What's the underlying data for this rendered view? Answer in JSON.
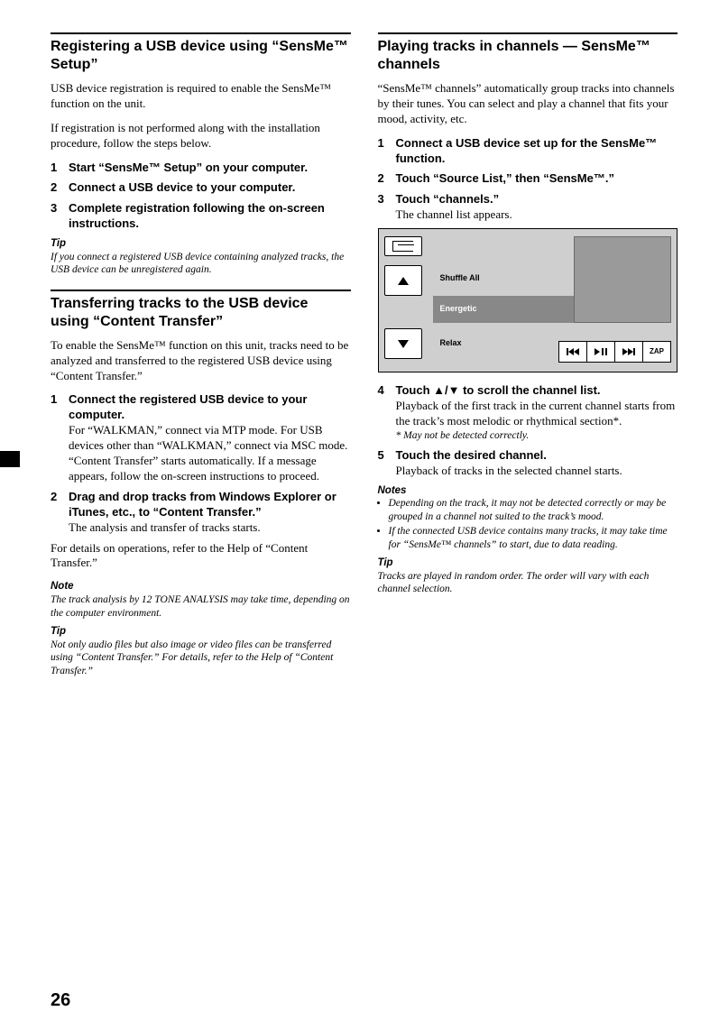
{
  "page_number": "26",
  "left": {
    "sect1_title": "Registering a USB device using “SensMe™ Setup”",
    "sect1_p1": "USB device registration is required to enable the SensMe™ function on the unit.",
    "sect1_p2": "If registration is not performed along with the installation procedure, follow the steps below.",
    "sect1_steps": [
      {
        "head": "Start “SensMe™ Setup” on your computer."
      },
      {
        "head": "Connect a USB device to your computer."
      },
      {
        "head": "Complete registration following the on-screen instructions."
      }
    ],
    "sect1_tip_label": "Tip",
    "sect1_tip": "If you connect a registered USB device containing analyzed tracks, the USB device can be unregistered again.",
    "sect2_title": "Transferring tracks to the USB device using “Content Transfer”",
    "sect2_p1": "To enable the SensMe™ function on this unit, tracks need to be analyzed and transferred to the registered USB device using “Content Transfer.”",
    "sect2_steps": [
      {
        "head": "Connect the registered USB device to your computer.",
        "body": "For “WALKMAN,” connect via MTP mode. For USB devices other than “WALKMAN,” connect via MSC mode. “Content Transfer” starts automatically. If a message appears, follow the on-screen instructions to proceed."
      },
      {
        "head": "Drag and drop tracks from Windows Explorer or iTunes, etc., to “Content Transfer.”",
        "body": "The analysis and transfer of tracks starts."
      }
    ],
    "sect2_p2": "For details on operations, refer to the Help of “Content Transfer.”",
    "sect2_note_label": "Note",
    "sect2_note": "The track analysis by 12 TONE ANALYSIS may take time, depending on the computer environment.",
    "sect2_tip_label": "Tip",
    "sect2_tip": "Not only audio files but also image or video files can be transferred using “Content Transfer.” For details, refer to the Help of “Content Transfer.”"
  },
  "right": {
    "sect3_title": "Playing tracks in channels — SensMe™ channels",
    "sect3_p1": "“SensMe™ channels” automatically group tracks into channels by their tunes. You can select and play a channel that fits your mood, activity, etc.",
    "sect3_steps_a": [
      {
        "head": "Connect a USB device set up for the SensMe™ function."
      },
      {
        "head": "Touch “Source List,” then “SensMe™.”"
      },
      {
        "head": "Touch “channels.”",
        "body": "The channel list appears."
      }
    ],
    "mockup": {
      "item_shuffle": "Shuffle All",
      "item_energetic": "Energetic",
      "item_relax": "Relax",
      "btn_zap": "ZAP"
    },
    "sect3_steps_b": [
      {
        "head": "Touch ▲/▼ to scroll the channel list.",
        "body": "Playback of the first track in the current channel starts from the track’s most melodic or rhythmical section*.",
        "foot": "* May not be detected correctly."
      },
      {
        "head": "Touch the desired channel.",
        "body": "Playback of tracks in the selected channel starts."
      }
    ],
    "sect3_notes_label": "Notes",
    "sect3_notes": [
      "Depending on the track, it may not be detected correctly or may be grouped in a channel not suited to the track’s mood.",
      "If the connected USB device contains many tracks, it may take time for “SensMe™ channels” to start, due to data reading."
    ],
    "sect3_tip_label": "Tip",
    "sect3_tip": "Tracks are played in random order. The order will vary with each channel selection."
  }
}
